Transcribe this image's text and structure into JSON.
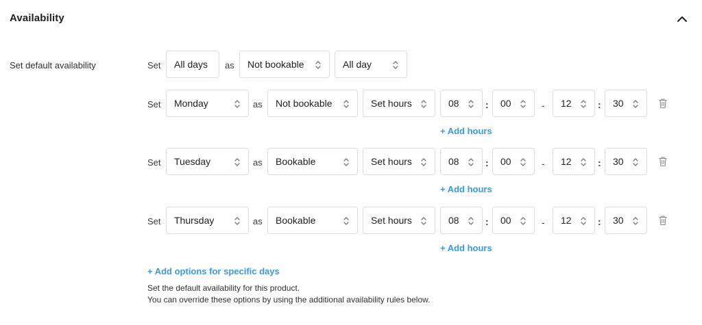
{
  "section": {
    "title": "Availability",
    "collapse_icon": "chevron-up-icon"
  },
  "default_availability": {
    "label": "Set default availability",
    "set_word": "Set",
    "as_word": "as",
    "days": "All days",
    "status": "Not bookable",
    "time_mode": "All day"
  },
  "rules": [
    {
      "set_word": "Set",
      "as_word": "as",
      "day": "Monday",
      "status": "Not bookable",
      "time_mode": "Set hours",
      "from_hour": "08",
      "from_minute": "00",
      "to_hour": "12",
      "to_minute": "30",
      "add_hours": "+ Add hours"
    },
    {
      "set_word": "Set",
      "as_word": "as",
      "day": "Tuesday",
      "status": "Bookable",
      "time_mode": "Set hours",
      "from_hour": "08",
      "from_minute": "00",
      "to_hour": "12",
      "to_minute": "30",
      "add_hours": "+ Add hours"
    },
    {
      "set_word": "Set",
      "as_word": "as",
      "day": "Thursday",
      "status": "Bookable",
      "time_mode": "Set hours",
      "from_hour": "08",
      "from_minute": "00",
      "to_hour": "12",
      "to_minute": "30",
      "add_hours": "+ Add hours"
    }
  ],
  "separators": {
    "range": "-",
    "time": ":"
  },
  "add_options_link": "+ Add options for specific days",
  "help_text": [
    "Set the default availability for this product.",
    "You can override these options by using the additional availability rules below."
  ],
  "colors": {
    "link": "#3a9ad9",
    "border": "#dcdcde",
    "text": "#1e1e1e"
  }
}
